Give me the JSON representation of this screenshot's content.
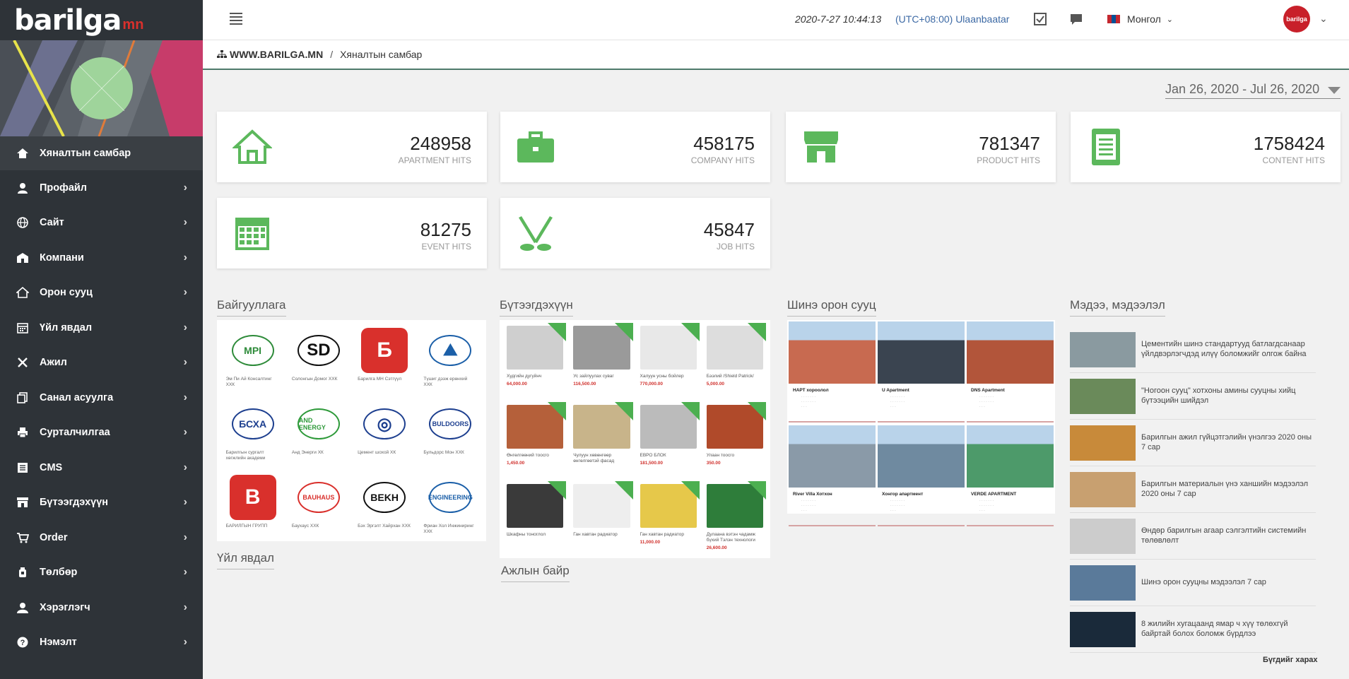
{
  "sidebar": {
    "logo_text": "barilga",
    "logo_suffix": "mn",
    "items": [
      {
        "label": "Хяналтын самбар",
        "icon": "home-icon"
      },
      {
        "label": "Профайл",
        "icon": "user-icon"
      },
      {
        "label": "Сайт",
        "icon": "globe-icon"
      },
      {
        "label": "Компани",
        "icon": "company-icon"
      },
      {
        "label": "Орон сууц",
        "icon": "house-icon"
      },
      {
        "label": "Үйл явдал",
        "icon": "calendar-icon"
      },
      {
        "label": "Ажил",
        "icon": "tools-icon"
      },
      {
        "label": "Санал асуулга",
        "icon": "copy-icon"
      },
      {
        "label": "Сурталчилгаа",
        "icon": "print-icon"
      },
      {
        "label": "CMS",
        "icon": "list-icon"
      },
      {
        "label": "Бүтээгдэхүүн",
        "icon": "store-icon"
      },
      {
        "label": "Order",
        "icon": "cart-icon"
      },
      {
        "label": "Төлбөр",
        "icon": "bottle-icon"
      },
      {
        "label": "Хэрэглэгч",
        "icon": "users-icon"
      },
      {
        "label": "Нэмэлт",
        "icon": "question-icon"
      }
    ]
  },
  "topbar": {
    "datetime": "2020-7-27 10:44:13",
    "timezone": "(UTC+08:00) Ulaanbaatar",
    "language": "Монгол",
    "avatar_text": "barilga"
  },
  "breadcrumb": {
    "home": "WWW.BARILGA.MN",
    "separator": "/",
    "current": "Хяналтын самбар"
  },
  "daterange": "Jan 26, 2020 - Jul 26, 2020",
  "stats": [
    {
      "value": "248958",
      "label": "APARTMENT HITS",
      "icon": "house-outline-icon"
    },
    {
      "value": "458175",
      "label": "COMPANY HITS",
      "icon": "briefcase-icon"
    },
    {
      "value": "781347",
      "label": "PRODUCT HITS",
      "icon": "shop-icon"
    },
    {
      "value": "1758424",
      "label": "CONTENT HITS",
      "icon": "document-icon"
    },
    {
      "value": "81275",
      "label": "EVENT HITS",
      "icon": "calendar-grid-icon"
    },
    {
      "value": "45847",
      "label": "JOB HITS",
      "icon": "crossed-tools-icon"
    }
  ],
  "sections": {
    "orgs": "Байгууллага",
    "products": "Бүтээгдэхүүн",
    "apartments": "Шинэ орон сууц",
    "news": "Мэдээ, мэдээлэл",
    "events": "Үйл явдал",
    "jobs": "Ажлын байр"
  },
  "orgs": [
    {
      "logo": "MPI",
      "name": "Эм Пи Ай Консалтинг ХХК",
      "color": "#2e8b3a"
    },
    {
      "logo": "SD",
      "name": "Солонгын Домог ХХК",
      "color": "#111111"
    },
    {
      "logo": "Б",
      "name": "Барилга МН Сэтгүүл",
      "color": "#d9302c"
    },
    {
      "logo": "⛰",
      "name": "Түшиг дээж ерөнхий ХХК",
      "color": "#1b5fa8"
    },
    {
      "logo": "БСХА",
      "name": "Барилгын сургалт хөгжлийн академи",
      "color": "#1d3f8f"
    },
    {
      "logo": "AND ENERGY",
      "name": "Анд Энерги ХК",
      "color": "#2e9a3a"
    },
    {
      "logo": "◎",
      "name": "Цемент шохой ХК",
      "color": "#1d3f8f"
    },
    {
      "logo": "BULDOORS",
      "name": "Бульдорс Мон ХХК",
      "color": "#1d3f8f"
    },
    {
      "logo": "B",
      "name": "БАРИЛГЫН ГРУПП",
      "color": "#d9302c"
    },
    {
      "logo": "BAUHAUS",
      "name": "Баухаус ХХК",
      "color": "#d9302c"
    },
    {
      "logo": "BEKH",
      "name": "Бэх Эргэлт Хайрхан ХХК",
      "color": "#111111"
    },
    {
      "logo": "ENGINEERING",
      "name": "Фриан Хол Инжиниринг ХХК",
      "color": "#1b5fa8"
    }
  ],
  "products": [
    {
      "name": "Худгийн дугуйнч",
      "price": "64,000.00",
      "color": "#cfcfcf"
    },
    {
      "name": "Ус зайлуулах суваг",
      "price": "116,500.00",
      "color": "#9a9a9a"
    },
    {
      "name": "Халуун усны бойлер",
      "price": "770,000.00",
      "color": "#e8e8e8"
    },
    {
      "name": "Бээлий /Shield Patrick/",
      "price": "5,000.00",
      "color": "#dddddd"
    },
    {
      "name": "Өнгөлгөөний тоосго",
      "price": "1,450.00",
      "color": "#b5603a"
    },
    {
      "name": "Чулуун хөвөнгөөр өнгөлгөөтэй фасад",
      "price": "",
      "color": "#c8b48a"
    },
    {
      "name": "ЕВРО БЛОК",
      "price": "181,500.00",
      "color": "#bbbbbb"
    },
    {
      "name": "Улаан тоосго",
      "price": "350.00",
      "color": "#b04a2a"
    },
    {
      "name": "Шкафны тоноглол",
      "price": "",
      "color": "#3a3a3a"
    },
    {
      "name": "Ган хавтан радиатор",
      "price": "",
      "color": "#eeeeee"
    },
    {
      "name": "Ган хавтан радиатор",
      "price": "11,000.00",
      "color": "#e6c84a"
    },
    {
      "name": "Дулаана вэтэн чадамж бүхий Тэлэн технологи",
      "price": "26,600.00",
      "color": "#2e7d3a"
    }
  ],
  "apartments": [
    {
      "name": "НАРТ хороолол",
      "color": "#c86a50"
    },
    {
      "name": "U Apartment",
      "color": "#3a4450"
    },
    {
      "name": "DNS Apartment",
      "color": "#b2553a"
    },
    {
      "name": "River Villa Хотхон",
      "color": "#8a9aa8"
    },
    {
      "name": "Хонгор апартмент",
      "color": "#6f8aa0"
    },
    {
      "name": "VERDE APARTMENT",
      "color": "#4d9a6a"
    }
  ],
  "news": [
    {
      "title": "Цементийн шинэ стандартууд батлагдсанаар үйлдвэрлэгчдэд илүү боломжийг олгож байна",
      "color": "#8a9aa0"
    },
    {
      "title": "\"Ногоон сууц\" хотхоны амины сууцны хийц бүтээцийн шийдэл",
      "color": "#6a8a5a"
    },
    {
      "title": "Барилгын ажил гүйцэтгэлийн үнэлгээ 2020 оны 7 сар",
      "color": "#c88a3a"
    },
    {
      "title": "Барилгын материалын үнэ ханшийн мэдээлэл 2020 оны 7 сар",
      "color": "#c8a070"
    },
    {
      "title": "Өндөр барилгын агаар сэлгэлтийн системийн төлөвлөлт",
      "color": "#cccccc"
    },
    {
      "title": "Шинэ орон сууцны мэдээлэл 7 сар",
      "color": "#5a7a9a"
    },
    {
      "title": "8 жилийн хугацаанд ямар ч хүү төлөхгүй байртай болох боломж бүрдлээ",
      "color": "#1a2a3a"
    }
  ],
  "see_all": "Бүгдийг харах",
  "colors": {
    "sidebar_bg": "#2e3338",
    "accent_green": "#5cb85c",
    "brand_red": "#d9302c"
  }
}
